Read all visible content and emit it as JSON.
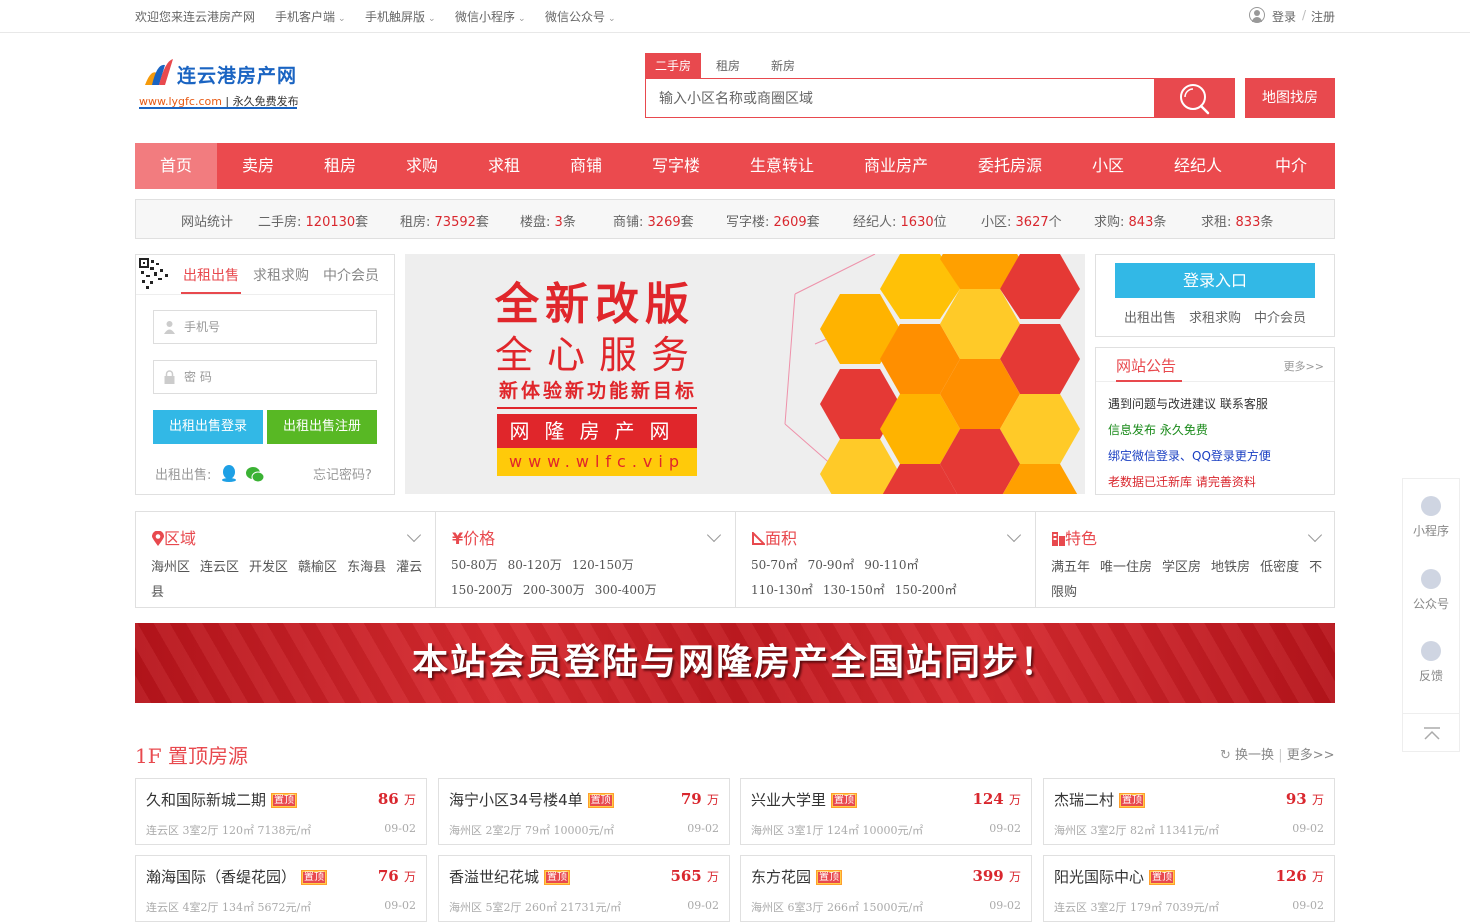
{
  "topbar": {
    "welcome": "欢迎您来连云港房产网",
    "links": [
      "手机客户端",
      "手机触屏版",
      "微信小程序",
      "微信公众号"
    ],
    "login": "登录",
    "sep": "/",
    "register": "注册"
  },
  "logo": {
    "title": "连云港房产网",
    "url": "www.lygfc.com",
    "slogan": "永久免费发布"
  },
  "search": {
    "tabs": [
      "二手房",
      "租房",
      "新房"
    ],
    "placeholder": "输入小区名称或商圈区域",
    "map_button": "地图找房"
  },
  "nav": [
    "首页",
    "卖房",
    "租房",
    "求购",
    "求租",
    "商铺",
    "写字楼",
    "生意转让",
    "商业房产",
    "委托房源",
    "小区",
    "经纪人",
    "中介"
  ],
  "stats": {
    "label": "网站统计",
    "items": [
      {
        "label": "二手房:",
        "value": "120130",
        "unit": "套"
      },
      {
        "label": "租房:",
        "value": "73592",
        "unit": "套"
      },
      {
        "label": "楼盘:",
        "value": "3",
        "unit": "条"
      },
      {
        "label": "商铺:",
        "value": "3269",
        "unit": "套"
      },
      {
        "label": "写字楼:",
        "value": "2609",
        "unit": "套"
      },
      {
        "label": "经纪人:",
        "value": "1630",
        "unit": "位"
      },
      {
        "label": "小区:",
        "value": "3627",
        "unit": "个"
      },
      {
        "label": "求购:",
        "value": "843",
        "unit": "条"
      },
      {
        "label": "求租:",
        "value": "833",
        "unit": "条"
      }
    ]
  },
  "login_panel": {
    "tabs": [
      "出租出售",
      "求租求购",
      "中介会员"
    ],
    "phone_placeholder": "手机号",
    "password_placeholder": "密 码",
    "login_button": "出租出售登录",
    "register_button": "出租出售注册",
    "social_label": "出租出售:",
    "forgot": "忘记密码?"
  },
  "banner": {
    "line1": "全新改版",
    "line2": "全心服务",
    "line3": "新体验新功能新目标",
    "line4": "网隆房产网",
    "line5": "www.wlfc.vip"
  },
  "right_login": {
    "button": "登录入口",
    "links": [
      "出租出售",
      "求租求购",
      "中介会员"
    ]
  },
  "notice": {
    "title": "网站公告",
    "more": "更多>>",
    "items": [
      {
        "text": "遇到问题与改进建议 联系客服",
        "color": "#333333"
      },
      {
        "text": "信息发布 永久免费",
        "color": "#1a8a1a"
      },
      {
        "text": "绑定微信登录、QQ登录更方便",
        "color": "#1a3fc2"
      },
      {
        "text": "老数据已迁新库 请完善资料",
        "color": "#d9272e"
      }
    ]
  },
  "filters": [
    {
      "icon": "location-icon",
      "title": "区域",
      "lines": [
        [
          "海州区",
          "连云区",
          "开发区",
          "赣榆区",
          "东海县",
          "灌云"
        ],
        [
          "县"
        ]
      ]
    },
    {
      "icon": "yuan-icon",
      "title": "价格",
      "lines": [
        [
          "50-80万",
          "80-120万",
          "120-150万"
        ],
        [
          "150-200万",
          "200-300万",
          "300-400万"
        ]
      ]
    },
    {
      "icon": "area-icon",
      "title": "面积",
      "lines": [
        [
          "50-70㎡",
          "70-90㎡",
          "90-110㎡"
        ],
        [
          "110-130㎡",
          "130-150㎡",
          "150-200㎡"
        ]
      ]
    },
    {
      "icon": "feature-icon",
      "title": "特色",
      "lines": [
        [
          "满五年",
          "唯一住房",
          "学区房",
          "地铁房",
          "低密度",
          "不"
        ],
        [
          "限购"
        ]
      ]
    }
  ],
  "promo": {
    "text": "本站会员登陆与网隆房产全国站同步！"
  },
  "section": {
    "title": "1F 置顶房源",
    "refresh": "换一换",
    "divider": "|",
    "more": "更多>>"
  },
  "listings": [
    {
      "name": "久和国际新城二期",
      "tag": "置顶",
      "price": "86",
      "unit": "万",
      "info": "连云区 3室2厅 120㎡ 7138元/㎡",
      "date": "09-02"
    },
    {
      "name": "海宁小区34号楼4单",
      "tag": "置顶",
      "price": "79",
      "unit": "万",
      "info": "海州区 2室2厅 79㎡ 10000元/㎡",
      "date": "09-02"
    },
    {
      "name": "兴业大学里",
      "tag": "置顶",
      "price": "124",
      "unit": "万",
      "info": "海州区 3室1厅 124㎡ 10000元/㎡",
      "date": "09-02"
    },
    {
      "name": "杰瑞二村",
      "tag": "置顶",
      "price": "93",
      "unit": "万",
      "info": "海州区 3室2厅 82㎡ 11341元/㎡",
      "date": "09-02"
    },
    {
      "name": "瀚海国际（香缇花园）",
      "tag": "置顶",
      "price": "76",
      "unit": "万",
      "info": "连云区 4室2厅 134㎡ 5672元/㎡",
      "date": "09-02"
    },
    {
      "name": "香溢世纪花城",
      "tag": "置顶",
      "price": "565",
      "unit": "万",
      "info": "海州区 5室2厅 260㎡ 21731元/㎡",
      "date": "09-02"
    },
    {
      "name": "东方花园",
      "tag": "置顶",
      "price": "399",
      "unit": "万",
      "info": "海州区 6室3厅 266㎡ 15000元/㎡",
      "date": "09-02"
    },
    {
      "name": "阳光国际中心",
      "tag": "置顶",
      "price": "126",
      "unit": "万",
      "info": "连云区 3室2厅 179㎡ 7039元/㎡",
      "date": "09-02"
    }
  ],
  "side_float": {
    "items": [
      "小程序",
      "公众号",
      "反馈"
    ]
  },
  "colors": {
    "accent": "#e8494e",
    "nav_bg": "#eb4a4e",
    "login_blue": "#32b8e6",
    "register_green": "#58b824",
    "price_red": "#d9272e"
  }
}
